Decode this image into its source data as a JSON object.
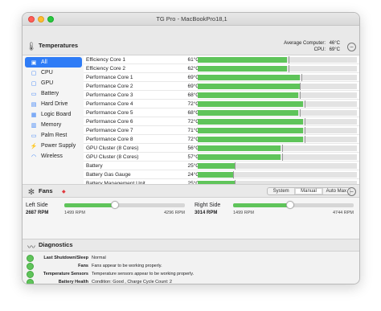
{
  "window": {
    "title": "TG Pro - MacBookPro18,1"
  },
  "temperatures": {
    "title": "Temperatures",
    "average_computer_label": "Average Computer:",
    "average_computer_value": "46°C",
    "cpu_label": "CPU:",
    "cpu_value": "69°C",
    "collapse_symbol": "−"
  },
  "sidebar": {
    "items": [
      {
        "label": "All",
        "icon": "grid-icon",
        "glyph": "▣",
        "active": true
      },
      {
        "label": "CPU",
        "icon": "cpu-icon",
        "glyph": "▢",
        "active": false
      },
      {
        "label": "GPU",
        "icon": "gpu-icon",
        "glyph": "▢",
        "active": false
      },
      {
        "label": "Battery",
        "icon": "battery-icon",
        "glyph": "▭",
        "active": false
      },
      {
        "label": "Hard Drive",
        "icon": "hard-drive-icon",
        "glyph": "▤",
        "active": false
      },
      {
        "label": "Logic Board",
        "icon": "logic-board-icon",
        "glyph": "▦",
        "active": false
      },
      {
        "label": "Memory",
        "icon": "memory-icon",
        "glyph": "▥",
        "active": false
      },
      {
        "label": "Palm Rest",
        "icon": "palm-rest-icon",
        "glyph": "▭",
        "active": false
      },
      {
        "label": "Power Supply",
        "icon": "power-supply-icon",
        "glyph": "⚡",
        "active": false
      },
      {
        "label": "Wireless",
        "icon": "wireless-icon",
        "glyph": "◠",
        "active": false
      }
    ]
  },
  "sensors": [
    {
      "name": "Efficiency Core 1",
      "value": "61°C",
      "fill": 0.56,
      "marker": 0.57
    },
    {
      "name": "Efficiency Core 2",
      "value": "62°C",
      "fill": 0.56,
      "marker": 0.57
    },
    {
      "name": "Performance Core 1",
      "value": "69°C",
      "fill": 0.64,
      "marker": 0.65
    },
    {
      "name": "Performance Core 2",
      "value": "69°C",
      "fill": 0.64,
      "marker": 0.64
    },
    {
      "name": "Performance Core 3",
      "value": "68°C",
      "fill": 0.63,
      "marker": 0.64
    },
    {
      "name": "Performance Core 4",
      "value": "72°C",
      "fill": 0.66,
      "marker": 0.67
    },
    {
      "name": "Performance Core 5",
      "value": "68°C",
      "fill": 0.63,
      "marker": 0.64
    },
    {
      "name": "Performance Core 6",
      "value": "72°C",
      "fill": 0.66,
      "marker": 0.67
    },
    {
      "name": "Performance Core 7",
      "value": "71°C",
      "fill": 0.66,
      "marker": 0.67
    },
    {
      "name": "Performance Core 8",
      "value": "72°C",
      "fill": 0.66,
      "marker": 0.67
    },
    {
      "name": "GPU Cluster (8 Cores)",
      "value": "56°C",
      "fill": 0.52,
      "marker": 0.53
    },
    {
      "name": "GPU Cluster (8 Cores)",
      "value": "57°C",
      "fill": 0.52,
      "marker": 0.53
    },
    {
      "name": "Battery",
      "value": "25°C",
      "fill": 0.23,
      "marker": 0.23
    },
    {
      "name": "Battery Gas Gauge",
      "value": "24°C",
      "fill": 0.22,
      "marker": 0.22
    },
    {
      "name": "Battery Management Unit",
      "value": "25°C",
      "fill": 0.23,
      "marker": 0.23
    }
  ],
  "fans": {
    "title": "Fans",
    "alert_symbol": "◆",
    "modes": [
      "System",
      "Manual",
      "Auto Max"
    ],
    "active_mode": "Manual",
    "collapse_symbol": "−",
    "items": [
      {
        "name": "Left Side",
        "rpm": "2687 RPM",
        "min": "1499 RPM",
        "max": "4296 RPM",
        "level": 0.42
      },
      {
        "name": "Right Side",
        "rpm": "3014 RPM",
        "min": "1499 RPM",
        "max": "4744 RPM",
        "level": 0.47
      }
    ]
  },
  "diagnostics": {
    "title": "Diagnostics",
    "items": [
      {
        "label": "Last Shutdown/Sleep",
        "text": "Normal"
      },
      {
        "label": "Fans",
        "text": "Fans appear to be working properly."
      },
      {
        "label": "Temperature Sensors",
        "text": "Temperature sensors appear to be working properly."
      },
      {
        "label": "Battery Health",
        "text": "Condition: Good , Charge Cycle Count: 2"
      }
    ]
  },
  "colors": {
    "accent": "#2f7cf6",
    "bar_green": "#5fc45a",
    "alert_red": "#e0393e"
  }
}
